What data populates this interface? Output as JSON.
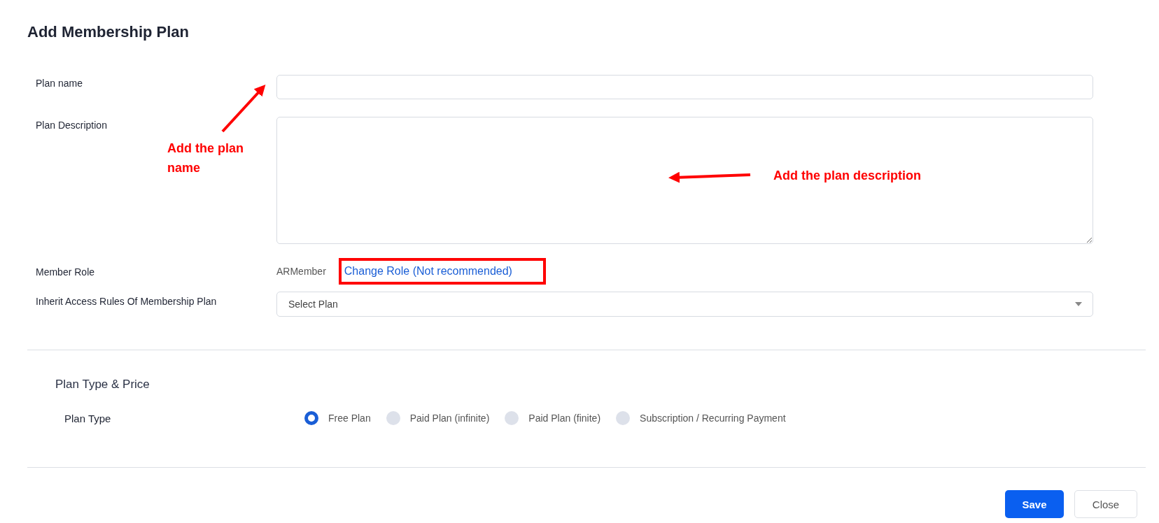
{
  "title": "Add Membership Plan",
  "fields": [
    {
      "kind": "input",
      "label": "Plan name"
    },
    {
      "kind": "textarea",
      "label": "Plan Description"
    },
    {
      "kind": "role",
      "label": "Member Role",
      "value": "ARMember",
      "link": "Change Role (Not recommended)"
    },
    {
      "kind": "select",
      "label": "Inherit Access Rules Of Membership Plan",
      "placeholder": "Select Plan"
    }
  ],
  "section": {
    "title": "Plan Type & Price",
    "label": "Plan Type",
    "options": [
      {
        "label": "Free Plan",
        "selected": true
      },
      {
        "label": "Paid Plan (infinite)",
        "selected": false
      },
      {
        "label": "Paid Plan (finite)",
        "selected": false
      },
      {
        "label": "Subscription / Recurring Payment",
        "selected": false
      }
    ]
  },
  "buttons": [
    {
      "kind": "primary",
      "label": "Save"
    },
    {
      "kind": "secondary",
      "label": "Close"
    }
  ],
  "annotations": [
    {
      "kind": "name",
      "text": "Add the plan name"
    },
    {
      "kind": "description",
      "text": "Add the plan description"
    }
  ]
}
